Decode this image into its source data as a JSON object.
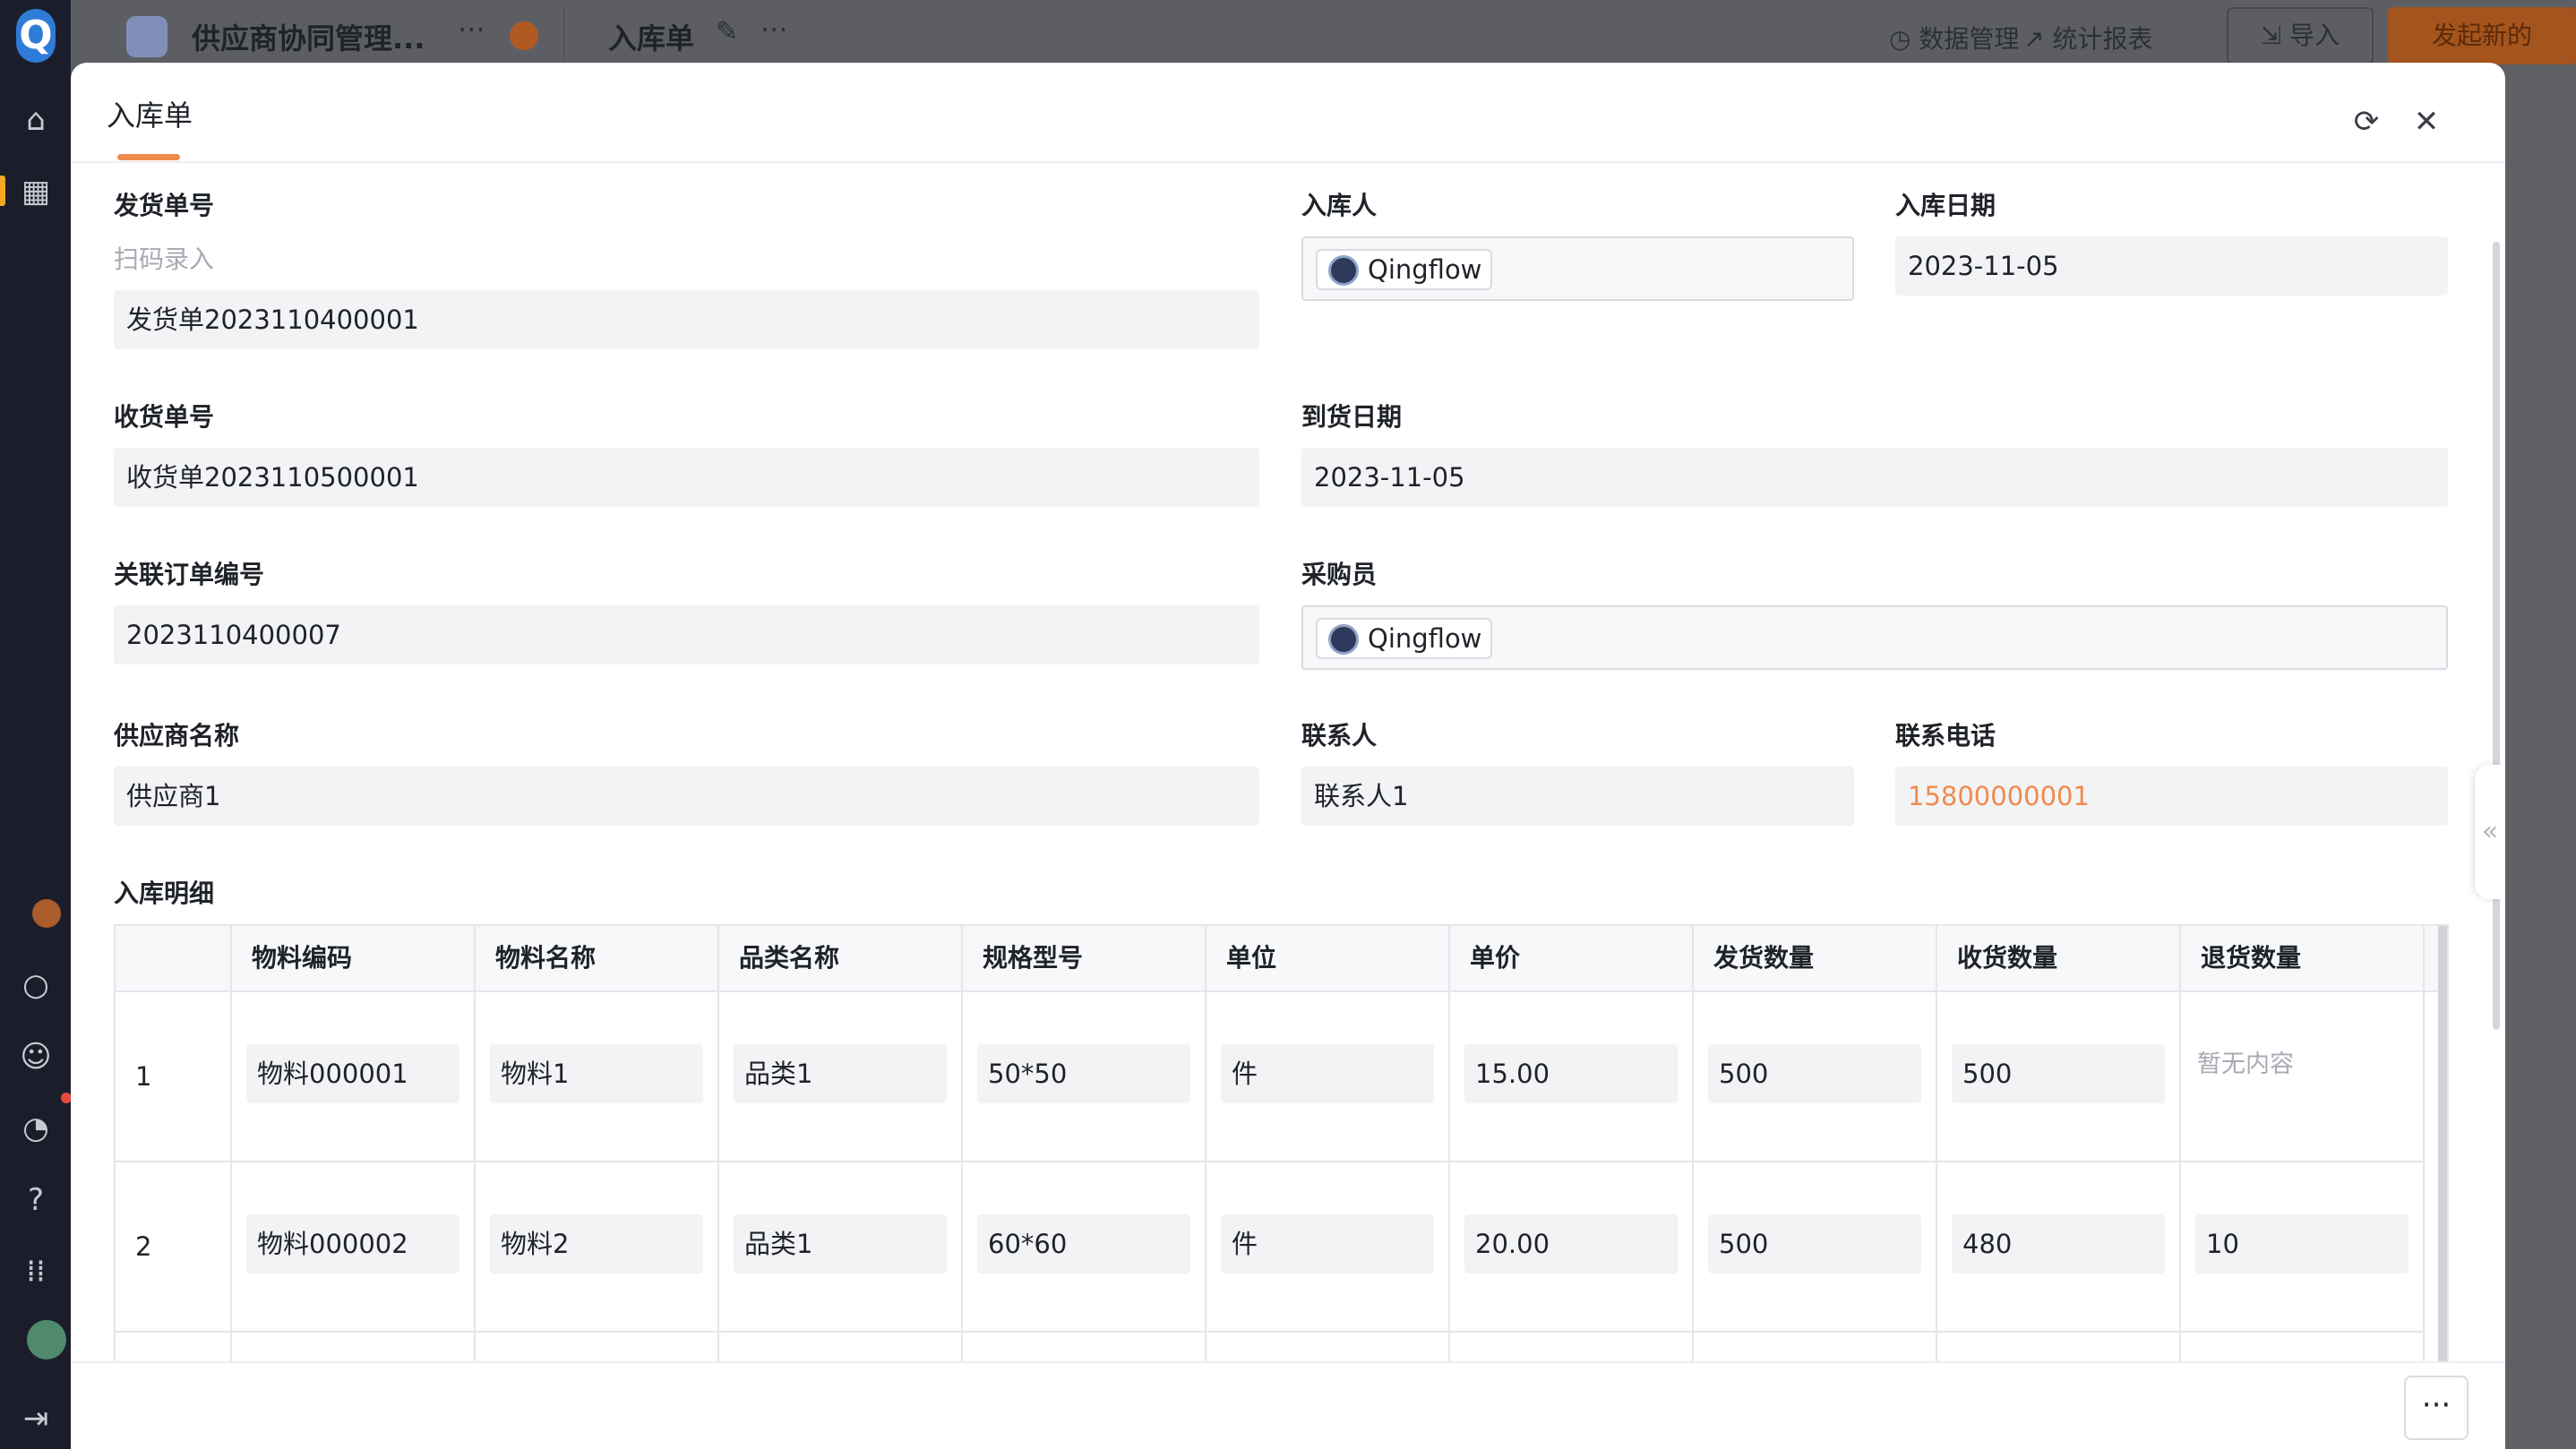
{
  "topbar": {
    "app_title": "供应商协同管理...",
    "form_title": "入库单",
    "data_manage": "数据管理",
    "stats_report": "统计报表",
    "import_label": "导入",
    "new_label": "发起新的"
  },
  "rail": {
    "logo": "Q"
  },
  "modal": {
    "title": "入库单",
    "fields": {
      "ship_no": {
        "label": "发货单号",
        "hint": "扫码录入",
        "value": "发货单2023110400001"
      },
      "receiver": {
        "label": "入库人",
        "value": "Qingflow"
      },
      "in_date": {
        "label": "入库日期",
        "value": "2023-11-05"
      },
      "receipt_no": {
        "label": "收货单号",
        "value": "收货单2023110500001"
      },
      "arrive_date": {
        "label": "到货日期",
        "value": "2023-11-05"
      },
      "order_no": {
        "label": "关联订单编号",
        "value": "2023110400007"
      },
      "buyer": {
        "label": "采购员",
        "value": "Qingflow"
      },
      "supplier": {
        "label": "供应商名称",
        "value": "供应商1"
      },
      "contact": {
        "label": "联系人",
        "value": "联系人1"
      },
      "phone": {
        "label": "联系电话",
        "value": "15800000001"
      }
    },
    "detail": {
      "label": "入库明细",
      "columns": [
        "物料编码",
        "物料名称",
        "品类名称",
        "规格型号",
        "单位",
        "单价",
        "发货数量",
        "收货数量",
        "退货数量"
      ],
      "rows": [
        {
          "index": "1",
          "cells": [
            "物料000001",
            "物料1",
            "品类1",
            "50*50",
            "件",
            "15.00",
            "500",
            "500"
          ],
          "return_qty_empty": "暂无内容"
        },
        {
          "index": "2",
          "cells": [
            "物料000002",
            "物料2",
            "品类1",
            "60*60",
            "件",
            "20.00",
            "500",
            "480",
            "10"
          ]
        }
      ]
    },
    "footer_more": "···"
  },
  "icons": {
    "refresh": "refresh-icon",
    "close": "close-icon"
  }
}
